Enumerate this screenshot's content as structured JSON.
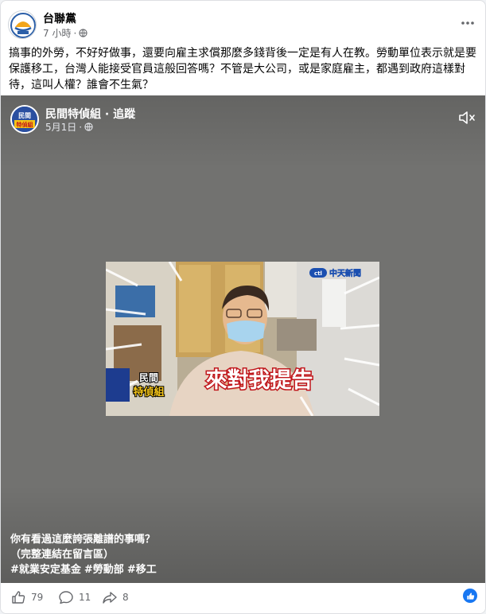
{
  "post": {
    "page_name": "台聯黨",
    "time": "7 小時",
    "separator": "·",
    "text": "搞事的外勞，不好好做事，還要向雇主求償那麼多錢背後一定是有人在教。勞動單位表示就是要保護移工，台灣人能接受官員這般回答嗎？不管是大公司，或是家庭雇主，都遇到政府這樣對待，這叫人權？誰會不生氣？",
    "logo_text": "台聯"
  },
  "video": {
    "author": "民間特偵組 · 追蹤",
    "date": "5月1日",
    "separator": "·",
    "avatar_text": [
      "民間",
      "特偵組"
    ],
    "frame": {
      "channel_logo": "中天新聞",
      "channel_badge": "ctl",
      "headline": "來對我提告",
      "badge_line1": "民間",
      "badge_line2": "特偵組"
    },
    "caption": {
      "line1": "你有看過這麼誇張離譜的事嗎？",
      "line2": "（完整連結在留言區）",
      "hashtags": [
        "#就業安定基金",
        "#勞動部",
        "#移工"
      ]
    }
  },
  "footer": {
    "likes": "79",
    "comments": "11",
    "shares": "8"
  },
  "colors": {
    "accent": "#1877f2",
    "video_bg": "#727270",
    "headline_fill": "#ffffff",
    "headline_stroke": "#c0161b"
  },
  "icons": [
    "globe-icon",
    "more-icon",
    "mute-icon",
    "like-icon",
    "comment-icon",
    "share-icon",
    "like-reaction-icon"
  ]
}
